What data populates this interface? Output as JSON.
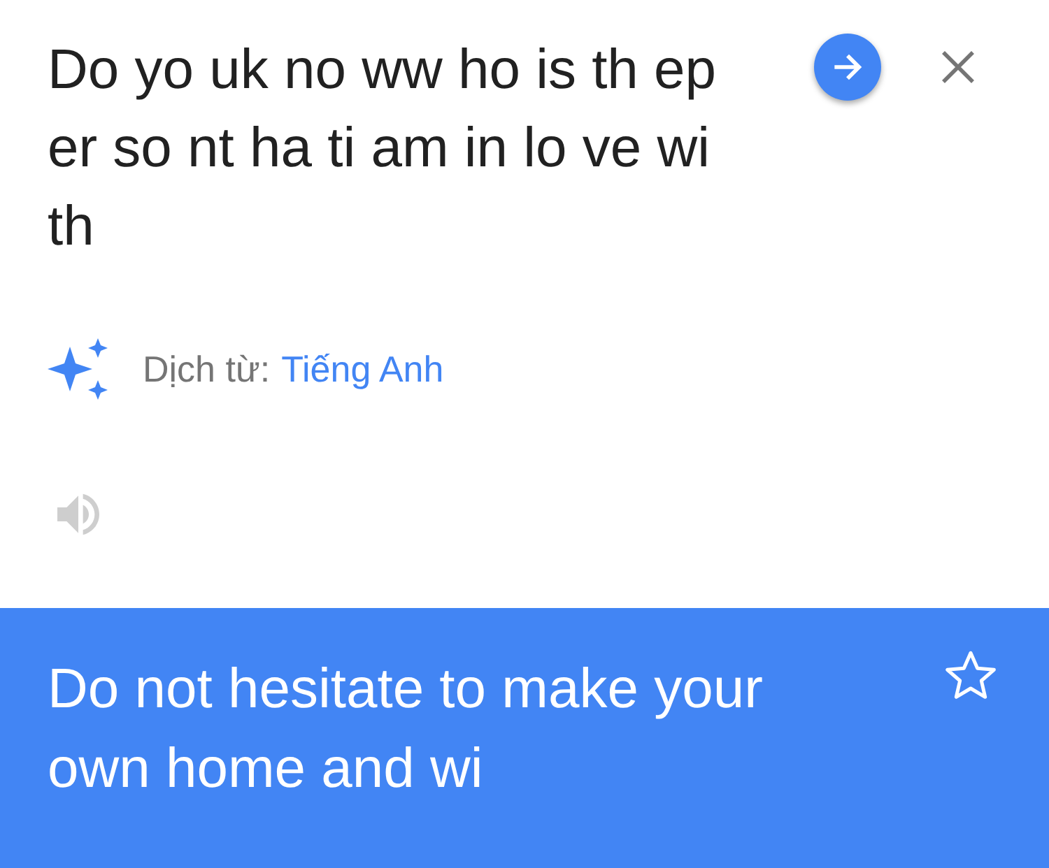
{
  "input": {
    "text": "Do yo uk no ww ho is th ep er so nt ha ti am in lo ve wi th"
  },
  "detection": {
    "label": "Dịch từ:",
    "language": "Tiếng Anh"
  },
  "speaker": {
    "disabled": true
  },
  "result": {
    "text": "Do not hesitate to make your own home and wi",
    "starred": false
  }
}
